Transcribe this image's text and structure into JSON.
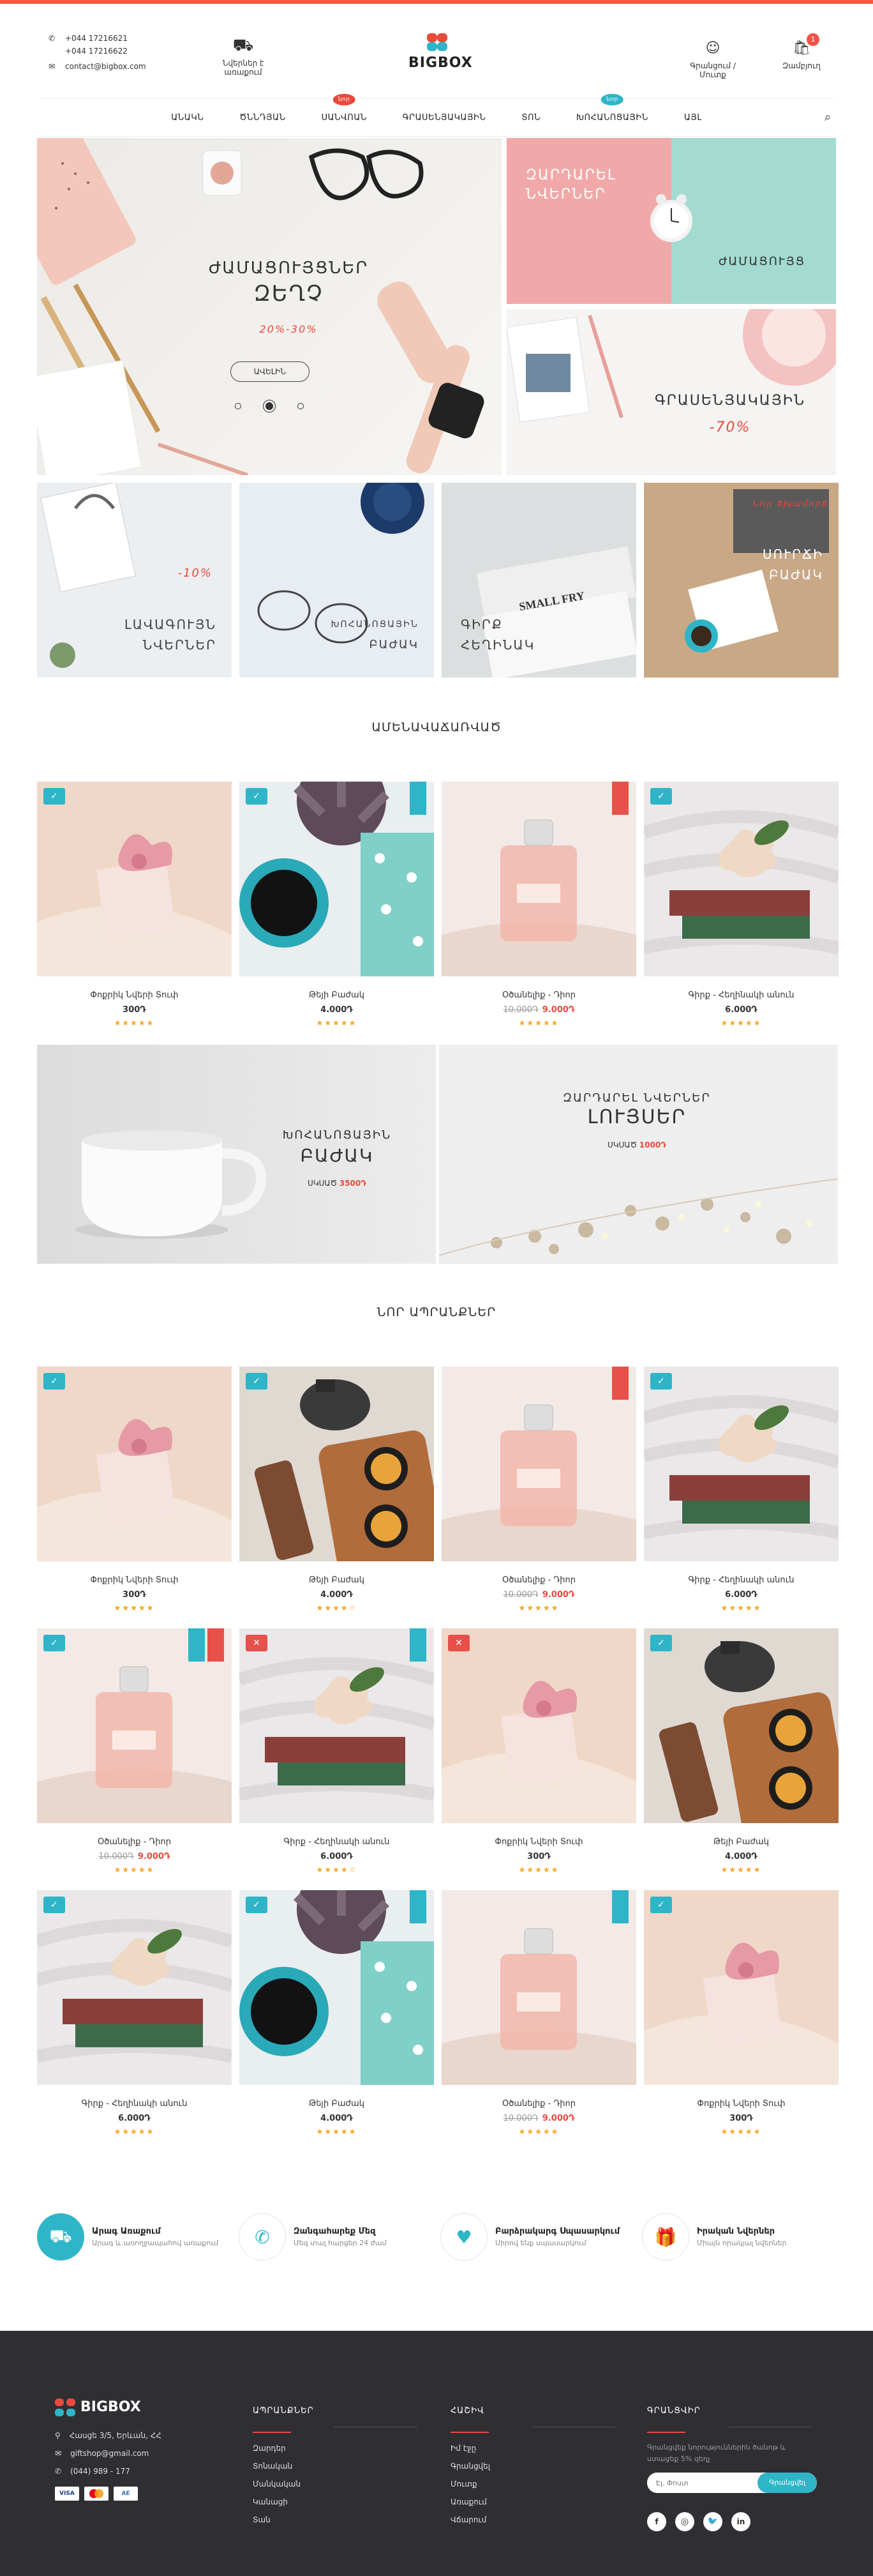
{
  "header": {
    "phone1": "+044 17216621",
    "phone2": "+044 17216622",
    "email": "contact@bigbox.com",
    "gift_label": "Նվերներ է առաքում",
    "logo": "BIGBOX",
    "account_label": "Գրանցում / Մուտք",
    "cart_label": "Զամբյուղ",
    "cart_count": "1"
  },
  "nav": {
    "items": [
      {
        "label": "ԱՆԱԿՆ",
        "badge": ""
      },
      {
        "label": "ԾՆՆԴՅԱՆ",
        "badge": ""
      },
      {
        "label": "ՍԱՆՎՈԱՆ",
        "badge": "նոր"
      },
      {
        "label": "ԳՐԱՍԵՆՅԱԿԱՅԻՆ",
        "badge": ""
      },
      {
        "label": "ՏՈՆ",
        "badge": ""
      },
      {
        "label": "ԽՈՀԱՆՈՑԱՅԻՆ",
        "badge": "նոր"
      },
      {
        "label": "ԱՅԼ",
        "badge": ""
      }
    ]
  },
  "hero": {
    "title1": "ԺԱՄԱՑՈՒՅՑՆԵՐ",
    "title2": "ԶԵՂՉ",
    "discount": "20%-30%",
    "button": "ԱՎԵԼԻՆ",
    "tile2_title1": "ԶԱՐԴԱՐԵԼ",
    "tile2_title2": "ՆՎԵՐՆԵՐ",
    "tile2_sub": "ԺԱՄԱՑՈՒՅՑ",
    "tile3_title": "ԳՐԱՍԵՆՅԱԿԱՅԻՆ",
    "tile3_discount": "-70%"
  },
  "cats": [
    {
      "discount": "-10%",
      "line1": "ԼԱՎԱԳՈՒՅՆ",
      "line2": "ՆՎԵՐՆԵՐ",
      "tag": ""
    },
    {
      "discount": "",
      "line1": "ԽՈՀԱՆՈՑԱՅԻՆ",
      "line2": "ԲԱԺԱԿ",
      "tag": ""
    },
    {
      "discount": "",
      "line1": "ԳԻՐՔ",
      "line2": "ՀԵՂԻՆԱԿ",
      "tag": ""
    },
    {
      "discount": "",
      "line1": "ՍՈՒՐՃԻ",
      "line2": "ԲԱԺԱԿ",
      "tag": "Նոր ծխամորճ"
    }
  ],
  "section1_title": "ԱՄԵՆԱՎԱՃԱՌՎԱԾ",
  "section2_title": "ՆՈՐ ԱՊՐԱՆՔՆԵՐ",
  "banners": [
    {
      "title1": "ԽՈՀԱՆՈՑԱՅԻՆ",
      "title2": "ԲԱԺԱԿ",
      "price_label": "ՍԿՍԱԾ",
      "price": "3500Դ"
    },
    {
      "title1": "ԶԱՐԴԱՐԵԼ ՆՎԵՐՆԵՐ",
      "title2": "ԼՈՒՅՍԵՐ",
      "price_label": "ՍԿՍԱԾ",
      "price": "1000Դ"
    }
  ],
  "products1": [
    {
      "name": "Փոքրիկ Նվերի Տուփ",
      "old": "",
      "price": "300Դ",
      "sale": false,
      "stars": "★★★★★",
      "img": "box",
      "tag": "ok",
      "ribbon": ""
    },
    {
      "name": "Թեյի Բաժակ",
      "old": "",
      "price": "4.000Դ",
      "sale": false,
      "stars": "★★★★★",
      "img": "cup",
      "tag": "ok",
      "ribbon": "b"
    },
    {
      "name": "Օծանելիք - Դիոր",
      "old": "10.000Դ",
      "price": "9.000Դ",
      "sale": true,
      "stars": "★★★★★",
      "img": "perfume",
      "tag": "",
      "ribbon": "r"
    },
    {
      "name": "Գիրք - Հեղինակի անուն",
      "old": "",
      "price": "6.000Դ",
      "sale": false,
      "stars": "★★★★★",
      "img": "book",
      "tag": "ok",
      "ribbon": ""
    }
  ],
  "products2": [
    {
      "name": "Փոքրիկ Նվերի Տուփ",
      "old": "",
      "price": "300Դ",
      "sale": false,
      "stars": "★★★★★",
      "img": "box",
      "tag": "ok",
      "ribbon": ""
    },
    {
      "name": "Թեյի Բաժակ",
      "old": "",
      "price": "4.000Դ",
      "sale": false,
      "stars": "★★★★☆",
      "img": "tea",
      "tag": "ok",
      "ribbon": ""
    },
    {
      "name": "Օծանելիք - Դիոր",
      "old": "10.000Դ",
      "price": "9.000Դ",
      "sale": true,
      "stars": "★★★★★",
      "img": "perfume",
      "tag": "",
      "ribbon": "r"
    },
    {
      "name": "Գիրք - Հեղինակի անուն",
      "old": "",
      "price": "6.000Դ",
      "sale": false,
      "stars": "★★★★★",
      "img": "book",
      "tag": "ok",
      "ribbon": ""
    },
    {
      "name": "Օծանելիք - Դիոր",
      "old": "10.000Դ",
      "price": "9.000Դ",
      "sale": true,
      "stars": "★★★★★",
      "img": "perfume",
      "tag": "ok",
      "ribbon": "b2r"
    },
    {
      "name": "Գիրք - Հեղինակի անուն",
      "old": "",
      "price": "6.000Դ",
      "sale": false,
      "stars": "★★★★☆",
      "img": "book",
      "tag": "x",
      "ribbon": "b"
    },
    {
      "name": "Փոքրիկ Նվերի Տուփ",
      "old": "",
      "price": "300Դ",
      "sale": false,
      "stars": "★★★★★",
      "img": "box",
      "tag": "x",
      "ribbon": ""
    },
    {
      "name": "Թեյի Բաժակ",
      "old": "",
      "price": "4.000Դ",
      "sale": false,
      "stars": "★★★★★",
      "img": "tea",
      "tag": "ok",
      "ribbon": ""
    },
    {
      "name": "Գիրք - Հեղինակի անուն",
      "old": "",
      "price": "6.000Դ",
      "sale": false,
      "stars": "★★★★★",
      "img": "book",
      "tag": "ok",
      "ribbon": ""
    },
    {
      "name": "Թեյի Բաժակ",
      "old": "",
      "price": "4.000Դ",
      "sale": false,
      "stars": "★★★★★",
      "img": "cup",
      "tag": "ok",
      "ribbon": "b"
    },
    {
      "name": "Օծանելիք - Դիոր",
      "old": "10.000Դ",
      "price": "9.000Դ",
      "sale": true,
      "stars": "★★★★★",
      "img": "perfume",
      "tag": "",
      "ribbon": "b"
    },
    {
      "name": "Փոքրիկ Նվերի Տուփ",
      "old": "",
      "price": "300Դ",
      "sale": false,
      "stars": "★★★★★",
      "img": "box",
      "tag": "ok",
      "ribbon": ""
    }
  ],
  "features": [
    {
      "title": "Արագ Առաքում",
      "sub": "Արագ և առողջապահով առաքում",
      "icon": "truck-icon"
    },
    {
      "title": "Զանգահարեք Մեզ",
      "sub": "Մեզ տալ հարցեր 24 ժամ",
      "icon": "phone-icon"
    },
    {
      "title": "Բարձրակարգ Սպասարկում",
      "sub": "Սիրով ենք սպասարկում",
      "icon": "heart-icon"
    },
    {
      "title": "Իրական Նվերներ",
      "sub": "Միայն որակյալ նվերներ",
      "icon": "gift-icon"
    }
  ],
  "footer": {
    "logo": "BIGBOX",
    "address": "Հասցե 3/5, Երևան, ՀՀ",
    "email": "giftshop@gmail.com",
    "phone": "(044) 989 - 177",
    "payments": [
      "VISA",
      "MC",
      "AE"
    ],
    "col2_title": "ԱՊՐԱՆՔՆԵՐ",
    "col2_items": [
      "Զարդեր",
      "Տոնական",
      "Մանկական",
      "Կանացի",
      "Տան"
    ],
    "col3_title": "ՀԱՇԻՎ",
    "col3_items": [
      "Իմ էջը",
      "Գրանցվել",
      "Մուտք",
      "Առաքում",
      "Վճարում"
    ],
    "col4_title": "ԳՐԱՆՑՎԻՐ",
    "col4_text": "Գրանցվեք նորություններին ծանոթ և ստացեք 5% զեղչ",
    "search_placeholder": "Էլ. Փոստ",
    "subscribe_button": "Գրանցվել"
  }
}
